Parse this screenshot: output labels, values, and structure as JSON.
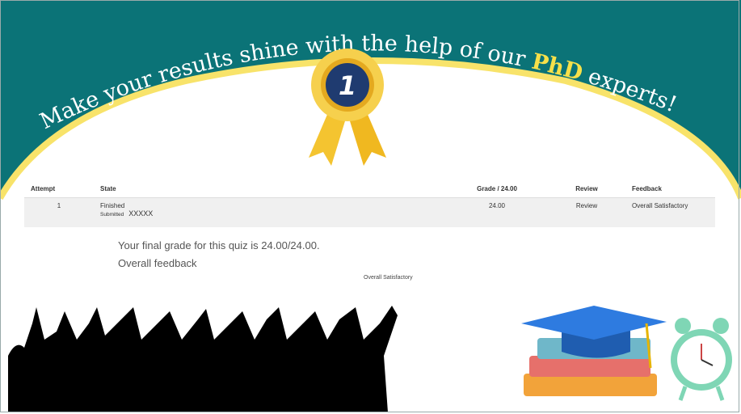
{
  "banner": {
    "headline_start": "Make your results shine with the help of our ",
    "headline_highlight": "PhD",
    "headline_end": " experts!",
    "badge_number": "1",
    "colors": {
      "teal": "#0b7377",
      "yellow": "#f8e36a",
      "highlight": "#f6e04a"
    }
  },
  "table": {
    "headers": [
      "Attempt",
      "State",
      "Grade / 24.00",
      "Review",
      "Feedback"
    ],
    "rows": [
      {
        "attempt": "1",
        "state": "Finished",
        "submitted_label": "Submitted",
        "submitted_value": "XXXXX",
        "grade": "24.00",
        "review": "Review",
        "feedback": "Overall Satisfactory"
      }
    ]
  },
  "summary": {
    "final_grade": "Your final grade for this quiz is 24.00/24.00.",
    "overall_feedback_label": "Overall feedback",
    "overall_feedback_value": "Overall Satisfactory"
  }
}
